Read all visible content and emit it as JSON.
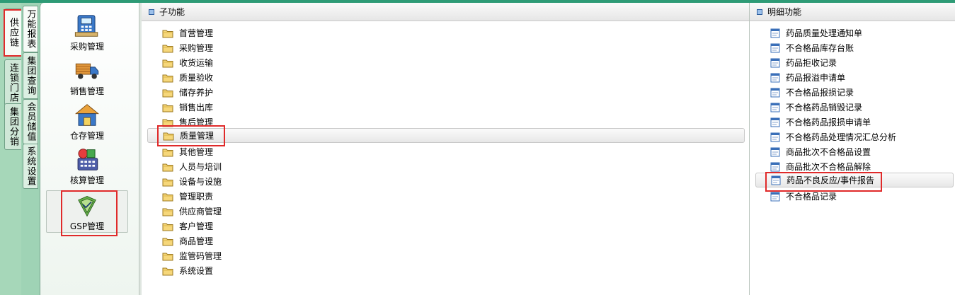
{
  "outer_tabs": [
    {
      "label": "供应链",
      "active": true
    },
    {
      "label": "连锁门店",
      "active": false
    },
    {
      "label": "集团分销",
      "active": false
    }
  ],
  "inner_tabs": [
    {
      "label": "万能报表",
      "active": true
    },
    {
      "label": "集团查询",
      "active": false
    },
    {
      "label": "会员储值",
      "active": false
    },
    {
      "label": "系统设置",
      "active": false
    }
  ],
  "modules": [
    {
      "label": "采购管理",
      "icon": "cash-register-icon"
    },
    {
      "label": "销售管理",
      "icon": "truck-icon"
    },
    {
      "label": "仓存管理",
      "icon": "warehouse-icon"
    },
    {
      "label": "核算管理",
      "icon": "calculator-icon"
    },
    {
      "label": "GSP管理",
      "icon": "gsp-certificate-icon",
      "selected": true
    }
  ],
  "sub_panel": {
    "title": "子功能",
    "items": [
      "首营管理",
      "采购管理",
      "收货运输",
      "质量验收",
      "储存养护",
      "销售出库",
      "售后管理",
      "质量管理",
      "其他管理",
      "人员与培训",
      "设备与设施",
      "管理职责",
      "供应商管理",
      "客户管理",
      "商品管理",
      "监管码管理",
      "系统设置"
    ],
    "selected": "质量管理"
  },
  "detail_panel": {
    "title": "明细功能",
    "items": [
      "药品质量处理通知单",
      "不合格品库存台账",
      "药品拒收记录",
      "药品报溢申请单",
      "不合格品报损记录",
      "不合格药品销毁记录",
      "不合格药品报损申请单",
      "不合格药品处理情况汇总分析",
      "商品批次不合格品设置",
      "商品批次不合格品解除",
      "药品不良反应/事件报告",
      "不合格品记录"
    ],
    "selected": "药品不良反应/事件报告"
  },
  "colors": {
    "highlight_box": "#e02a2a",
    "sidebar_bg": "#9fd3b5",
    "top_bar": "#2e9b76"
  }
}
